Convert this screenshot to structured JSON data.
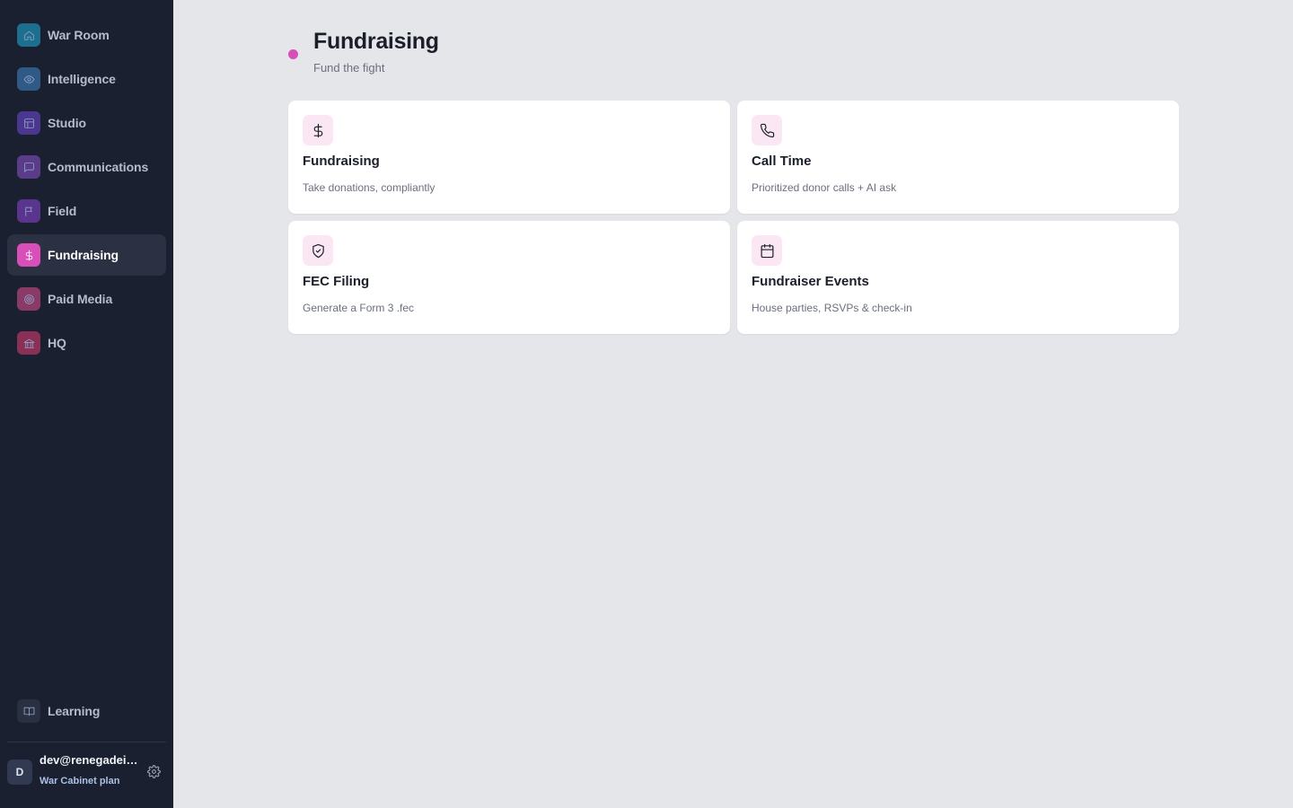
{
  "sidebar": {
    "items": [
      {
        "label": "War Room",
        "icon": "home-icon",
        "color": "#1e6f8f"
      },
      {
        "label": "Intelligence",
        "icon": "eye-icon",
        "color": "#2f5a86"
      },
      {
        "label": "Studio",
        "icon": "layout-icon",
        "color": "#4b3690"
      },
      {
        "label": "Communications",
        "icon": "message-icon",
        "color": "#5b3c8a"
      },
      {
        "label": "Field",
        "icon": "flag-icon",
        "color": "#5a3590"
      },
      {
        "label": "Fundraising",
        "icon": "dollar-icon",
        "color": "#d94fba",
        "active": true
      },
      {
        "label": "Paid Media",
        "icon": "target-icon",
        "color": "#8a3a66"
      },
      {
        "label": "HQ",
        "icon": "landmark-icon",
        "color": "#8a2f55"
      }
    ],
    "learning": {
      "label": "Learning",
      "icon": "book-icon",
      "color": "#2a3042"
    },
    "user": {
      "initial": "D",
      "email": "dev@renegadeinc.com",
      "plan": "War Cabinet plan"
    }
  },
  "header": {
    "title": "Fundraising",
    "subtitle": "Fund the fight",
    "dot_color": "#d94fba"
  },
  "cards": [
    {
      "title": "Fundraising",
      "description": "Take donations, compliantly",
      "icon": "dollar-icon"
    },
    {
      "title": "Call Time",
      "description": "Prioritized donor calls + AI ask",
      "icon": "phone-icon"
    },
    {
      "title": "FEC Filing",
      "description": "Generate a Form 3 .fec",
      "icon": "shield-check-icon"
    },
    {
      "title": "Fundraiser Events",
      "description": "House parties, RSVPs & check-in",
      "icon": "calendar-icon"
    }
  ]
}
